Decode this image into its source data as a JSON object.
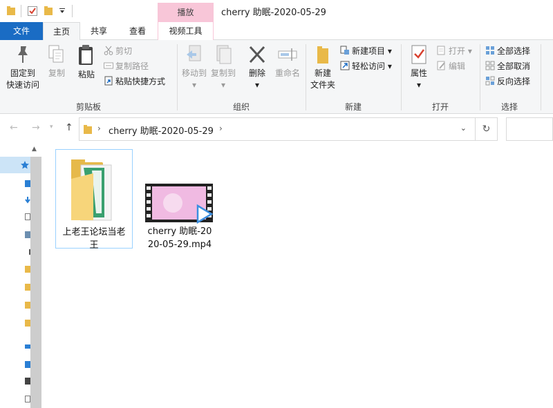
{
  "window": {
    "title": "cherry 助眠-2020-05-29",
    "contextual_tab": "播放"
  },
  "tabs": {
    "file": "文件",
    "home": "主页",
    "share": "共享",
    "view": "查看",
    "video_tools": "视频工具"
  },
  "ribbon": {
    "clipboard": {
      "label": "剪贴板",
      "pin": "固定到快速访问",
      "pin_line1": "固定到",
      "pin_line2": "快速访问",
      "copy": "复制",
      "paste": "粘贴",
      "cut": "剪切",
      "copy_path": "复制路径",
      "paste_shortcut": "粘贴快捷方式"
    },
    "organize": {
      "label": "组织",
      "move_to": "移动到",
      "copy_to": "复制到",
      "delete": "删除",
      "rename": "重命名"
    },
    "new": {
      "label": "新建",
      "new_folder_line1": "新建",
      "new_folder_line2": "文件夹",
      "new_item": "新建项目",
      "easy_access": "轻松访问"
    },
    "open": {
      "label": "打开",
      "properties": "属性",
      "open": "打开",
      "edit": "编辑"
    },
    "select": {
      "label": "选择",
      "select_all": "全部选择",
      "select_none": "全部取消",
      "invert": "反向选择"
    }
  },
  "address": {
    "path": "cherry 助眠-2020-05-29"
  },
  "files": [
    {
      "name": "上老王论坛当老王",
      "type": "folder",
      "selected": true
    },
    {
      "name": "cherry 助眠-2020-05-29.mp4",
      "type": "video",
      "selected": false
    }
  ],
  "colors": {
    "accent": "#1a6cc4",
    "contextual": "#f8c6d8",
    "selection": "#cce4f7"
  }
}
